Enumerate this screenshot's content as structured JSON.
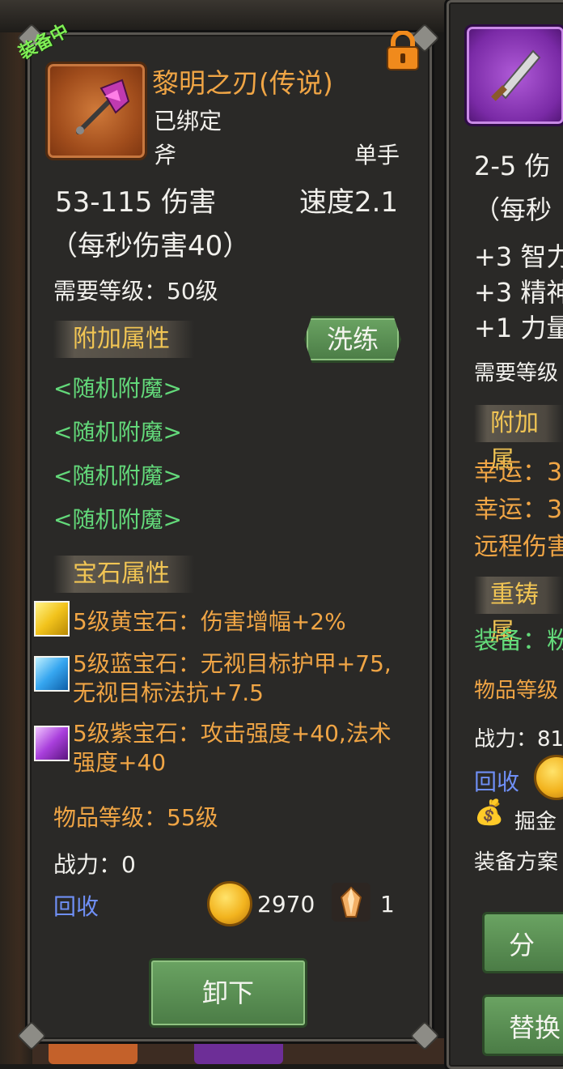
{
  "main": {
    "equipped_tag": "装备中",
    "item_name": "黎明之刃(传说)",
    "bound": "已绑定",
    "item_type": "斧",
    "hand": "单手",
    "damage": "53-115 伤害",
    "speed": "速度2.1",
    "dps": "（每秒伤害40）",
    "required_level": "需要等级：50级",
    "extra_attrs_title": "附加属性",
    "wash_button": "洗练",
    "random_enchants": [
      "<随机附魔>",
      "<随机附魔>",
      "<随机附魔>",
      "<随机附魔>"
    ],
    "gem_title": "宝石属性",
    "gems": [
      {
        "color": "#f2c31c",
        "icon": "yellow-gem-icon",
        "lines": [
          "5级黄宝石：伤害增幅+2%"
        ]
      },
      {
        "color": "#36a6f0",
        "icon": "blue-gem-icon",
        "lines": [
          "5级蓝宝石：无视目标护甲+75,",
          "无视目标法抗+7.5"
        ]
      },
      {
        "color": "#a93fdc",
        "icon": "purple-gem-icon",
        "lines": [
          "5级紫宝石：攻击强度+40,法术",
          "强度+40"
        ]
      }
    ],
    "item_level": "物品等级：55级",
    "power": "战力：0",
    "recycle": "回收",
    "gold_amount": "2970",
    "crystal_amount": "1",
    "unequip_button": "卸下"
  },
  "side": {
    "damage": "2-5 伤",
    "dps": "（每秒",
    "stats": [
      "+3 智力",
      "+3 精神",
      "+1 力量"
    ],
    "required_level": "需要等级",
    "extra_title": "附加属",
    "extra_stats": [
      "幸运：3",
      "幸运：3",
      "远程伤害"
    ],
    "reforge_title": "重铸属",
    "equip_line": "装备：粉",
    "item_level": "物品等级",
    "power": "战力：81",
    "recycle": "回收",
    "dig": "掘金",
    "equip_plan": "装备方案",
    "split_button": "分",
    "replace_button": "替换"
  }
}
